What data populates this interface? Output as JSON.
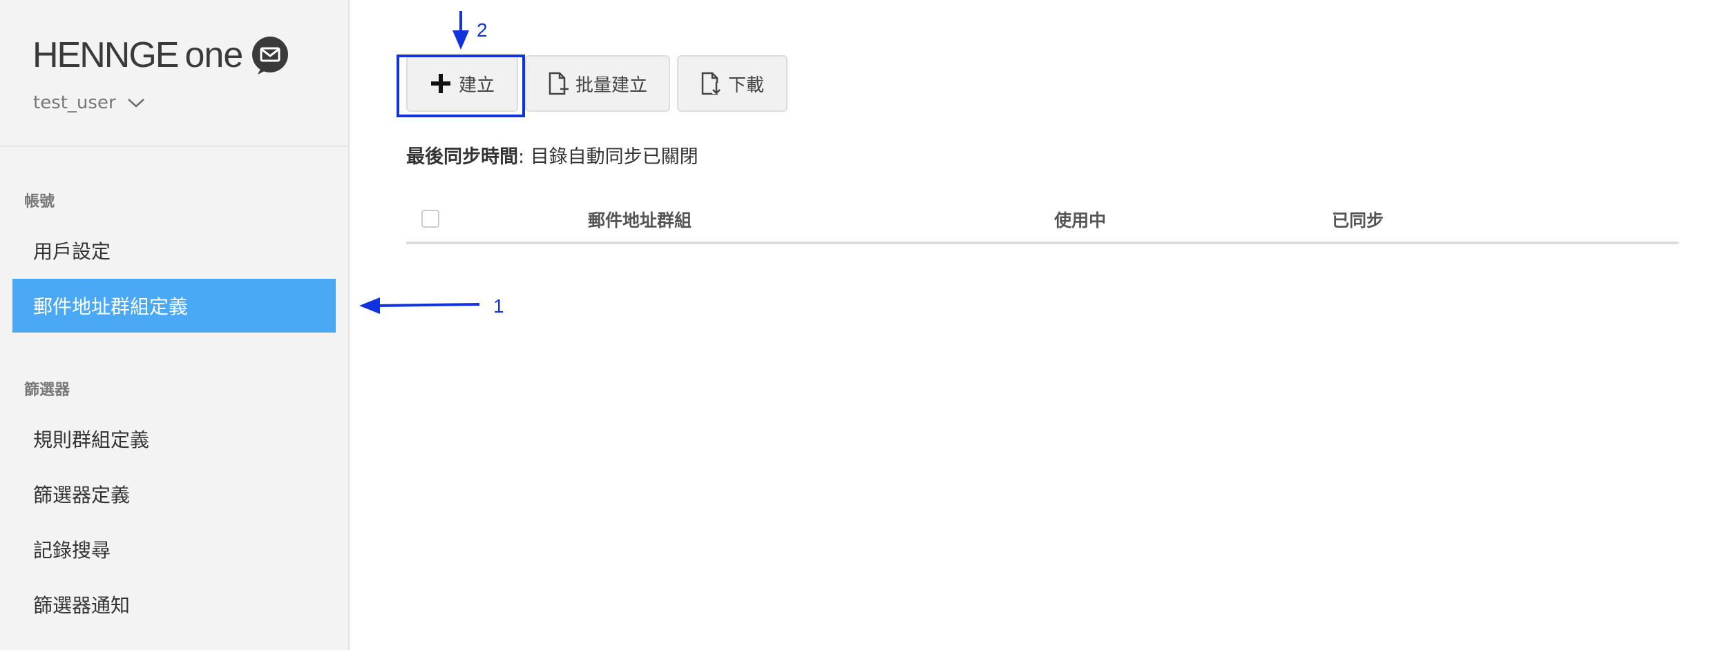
{
  "brand": {
    "name_part1": "HENNGE",
    "name_part2": "one",
    "icon": "mail-bubble-icon"
  },
  "user": {
    "name": "test_user",
    "icon": "chevron-down-icon"
  },
  "sidebar": {
    "sections": [
      {
        "title": "帳號",
        "items": [
          {
            "label": "用戶設定"
          },
          {
            "label": "郵件地址群組定義",
            "active": true
          }
        ]
      },
      {
        "title": "篩選器",
        "items": [
          {
            "label": "規則群組定義"
          },
          {
            "label": "篩選器定義"
          },
          {
            "label": "記錄搜尋"
          },
          {
            "label": "篩選器通知"
          }
        ]
      }
    ],
    "active_color": "#4aa8f5"
  },
  "toolbar": {
    "create_label": "建立",
    "batch_create_label": "批量建立",
    "download_label": "下載"
  },
  "sync": {
    "label": "最後同步時間",
    "separator": ": ",
    "value": "目錄自動同步已關閉"
  },
  "table": {
    "columns": [
      "郵件地址群組",
      "使用中",
      "已同步"
    ]
  },
  "annotations": {
    "arrow1_label": "1",
    "arrow2_label": "2",
    "color": "#1133dd"
  }
}
